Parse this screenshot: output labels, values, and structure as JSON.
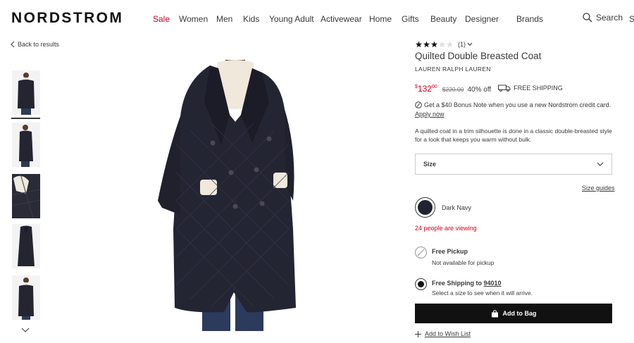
{
  "header": {
    "logo": "NORDSTROM",
    "nav": [
      "Sale",
      "Women",
      "Men",
      "Kids",
      "Young Adult",
      "Activewear",
      "Home",
      "Gifts",
      "Beauty",
      "Designer",
      "Brands"
    ],
    "search_label": "Search",
    "cut_label": "S"
  },
  "back_link": "Back to results",
  "product": {
    "rating": 3,
    "rating_max": 5,
    "review_count": "(1)",
    "title": "Quilted Double Breasted Coat",
    "brand": "LAUREN RALPH LAUREN",
    "price_currency": "$",
    "price_dollars": "132",
    "price_cents": "00",
    "original_price": "$220.00",
    "discount": "40% off",
    "shipping_badge": "FREE SHIPPING",
    "credit_offer": "Get a $40 Bonus Note when you use a new Nordstrom credit card.",
    "apply_now": "Apply now",
    "description": "A quilted coat in a trim silhouette is done in a classic double-breasted style for a look that keeps you warm without bulk.",
    "size_label": "Size",
    "size_guides": "Size guides",
    "color_name": "Dark Navy",
    "color_hex": "#22232e",
    "viewing_count": "24",
    "viewing_text": "people are viewing",
    "pickup_title": "Free Pickup",
    "pickup_sub": "Not available for pickup",
    "shipping_title_prefix": "Free Shipping to",
    "shipping_zip": "94010",
    "shipping_sub": "Select a size to see when it will arrive.",
    "add_to_bag": "Add to Bag",
    "wish_list": "Add to Wish List"
  },
  "colors": {
    "sale_red": "#d6001c",
    "text": "#393939",
    "button_bg": "#111111"
  }
}
